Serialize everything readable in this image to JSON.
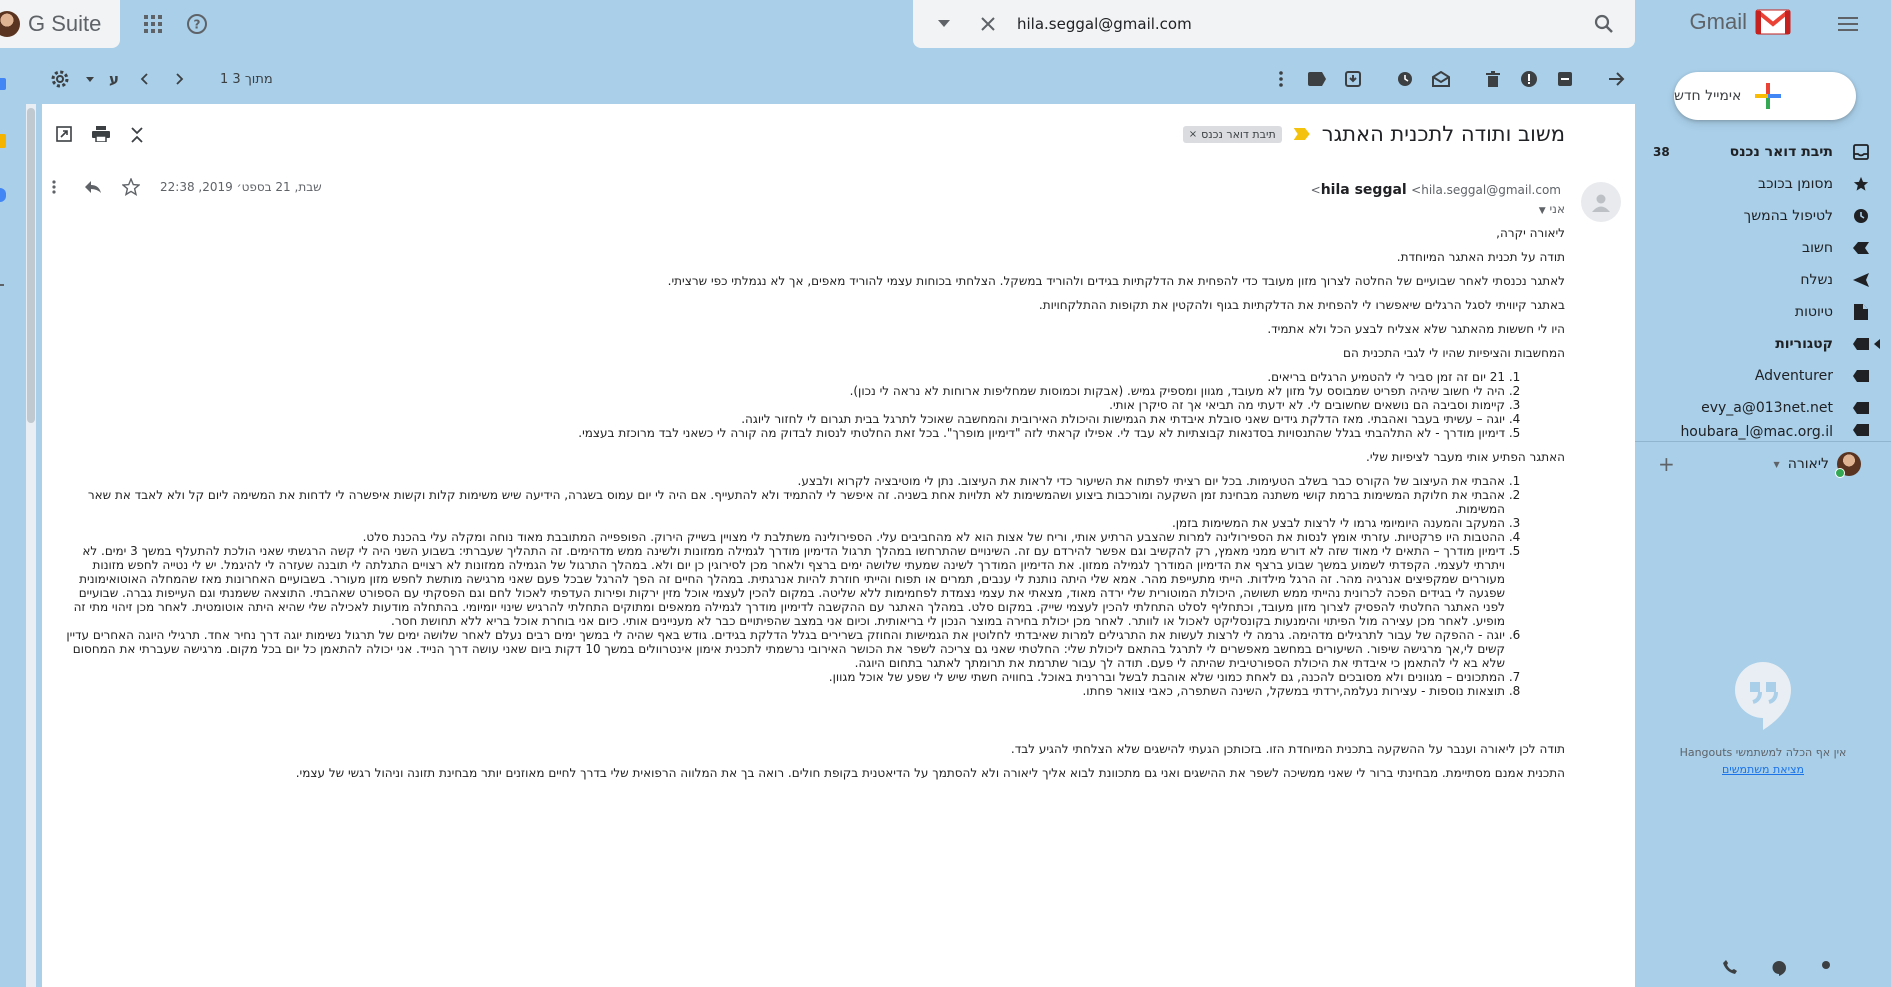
{
  "topbar": {
    "brand": "G Suite",
    "search_value": "hila.seggal@gmail.com",
    "gmail_label": "Gmail"
  },
  "toolbar": {
    "pager": "1 מתוך 3",
    "input_tools_label": "ע"
  },
  "email": {
    "subject": "משוב ותודה לתכנית האתגר",
    "label_chip": "תיבת דואר נכנס",
    "sender_name": "hila seggal",
    "sender_email": "<hila.seggal@gmail.com>",
    "to": "אני",
    "date": "שבת, 21 בספט׳ 2019, 22:38",
    "body": {
      "greeting": "ליאורה יקרה,",
      "p1": "תודה על תכנית האתגר המיוחדת.",
      "p2": "לאתגר נכנסתי לאחר שבועיים של החלטה לצרוך מזון מעובד כדי להפחית את הדלקתיות בגידים ולהוריד במשקל. הצלחתי  בכוחות עצמי להוריד מאפים, אך לא נגמלתי כפי שרציתי.",
      "p3": "באתגר קיוויתי לסגל הרגלים שיאפשרו לי להפחית את הדלקתיות בגוף ולהקטין את תקופות ההתלקחויות.",
      "p4": "היו לי חששות מהאתגר שלא אצליח לבצע הכל ולא אתמיד.",
      "p5": "המחשבות והציפיות שהיו לי לגבי התכנית הם",
      "list1": [
        "21 יום זה זמן סביר לי להטמיע הרגלים בריאים.",
        "היה לי חשוב שיהיה תפריט שמבוסס על מזון לא מעובד, מגוון ומספיק גמיש. (אבקות וכמוסות שמחליפות ארוחות לא נראה לי נכון).",
        "קיימות וסביבה הם נושאים שחשובים לי. לא ידעתי מה תביאי אך זה סיקרן אותי.",
        "יוגה – עשיתי בעבר ואהבתי. מאז הדלקת גידים שאני סובלת איבדתי את הגמישות והיכולת האירובית והמחשבה שאוכל לתרגל בבית תגרום לי לחזור ליוגה.",
        "דימיון מודרך -  לא התלהבתי בגלל שהתנסויות בסדנאות קבוצתיות לא עבד לי. אפילו קראתי לזה \"דימיון מופרך\". בכל זאת החלטתי לנסות לבדוק מה קורה לי כשאני לבד מרוכזת בעצמי."
      ],
      "p6": "האתגר הפתיע אותי מעבר לציפיות שלי.",
      "list2": [
        "אהבתי את העיצוב של הקורס כבר בשלב הטעימות. בכל יום רציתי לפתוח את השיעור כדי לראות את העיצוב. נתן לי מוטיבציה לקרוא ולבצע.",
        "אהבתי את חלוקת המשימות ברמת קושי משתנה מבחינת זמן השקעה ומורכבות ביצוע ושהמשימות לא תלויות אחת בשניה.  זה איפשר לי להתמיד ולא להתעייף. אם היה לי יום עמוס בשגרה, הידיעה שיש משימות קלות וקשות איפשרה לי לדחות את המשימה ליום קל ולא לאבד את שאר המשימות.",
        "המעקב והמענה היומיומי גרמו לי לרצות לבצע את המשימות בזמן.",
        "ההטבות היו פרקטיות. עזרתי אומץ לנסות את הספירולינה למרות שהצבע הרתיע אותי, וריח של אצות הוא לא מהחביבים עלי. הספירולינה משתלבת לי מצויין בשייק הירוק. הפופפייה המתובבת מאוד נוחה ומקלה עלי בהכנת סלט.",
        "דימיון מודרך –  התאים לי מאוד שזה לא דורש ממני מאמץ, רק להקשיב וגם אפשר להירדם עם זה. השינויים שהתרחשו במהלך תרגול הדימיון מודרך לגמילה ממזונות ולשינה ממש מדהימים. זה התהליך שעברתי: בשבוע השני היה לי קשה הרגשתי שאני הולכת להתעלף במשך 3 ימים. לא ויתרתי לעצמי. הקפדתי לשמוע במשך שבוע ברצף את הדימיון המודרך לגמילה ממזון. את הדימיון המודרך לשינה שמעתי שלושה ימים ברצף ולאחר מכן לסירוגין כן יום ולא. במהלך התרגול של הגמילה ממזונות לא רצויים התגלתה לי תובנה שעזרה לי להיגמל. יש לי נטייה לחפש מזונות מעוררים שמקפיצים אנרגיה מהר. זה הרגל מילדות. הייתי מתעייפת מהר. אמא  שלי היתה נותנת לי ענבים, תמרים או תפוח והייתי חוזרת להיות אנרגתית. במהלך החיים זה הפך להרגל שבכל פעם שאני מרגישה מותשת לחפש מזון מעורר. בשבועיים האחרונות מאז שהמחלה האוטואימונית שפגעה לי בגידים הפכה לכרונית נהייתי ממש תשושה, היכולת המוטורית שלי ירדה מאוד, מצאתי את עצמי נצמדת לפחמימות ללא שליטה. במקום להכין לעצמי אוכל מזין ירקות ופירות העדפתי לאכול לחם וגם הפסקתי עם הספורט שאהבתי. התוצאה ששמנתי וגם העייפות גברה. שבועיים לפני האתגר החלטתי להפסיק לצרוך מזון מעובד, וכתחליף לסלט התחלתי להכין לעצמי שייק. במקום סלט. במהלך האתגר עם ההקשבה לדימיון מודרך לגמילה ממאפים ומתוקים התחלתי להרגיש שינוי יומיומי. בהתחלה מודעות לאכילה שלי שהיא היתה אוטומטית. לאחר מכן זיהוי מתי זה מופיע. לאחר מכן  עצירה מול הפיתוי והימנעות בקונסליקט לאכול או לוותר. לאחר מכן יכולת בחירה במוצר הנכון לי בריאותית. וכיום אני במצב שהפיתויים כבר לא מעניינים אותי. כיום אני בוחרת אוכל בריא ללא תחושת חסר.",
        "יוגה -  ההפקה של עבור לתרגילים מדהימה. גרמה לי לרצות לעשות את התרגילים למרות שאיבדתי לחלוטין את הגמישות והחוזק בשרירים בגלל הדלקת בגידים. גודש באף שהיה לי במשך ימים רבים נעלם לאחר שלושה ימים של תרגול נשימות יוגה דרך נחיר אחד. תרגילי היוגה האחרים עדיין קשים לי,אך מרגישה שיפור. השיעורים במחשב מאפשרים לי לתרגל בהתאם ליכולת שלי: החלטתי שאני גם צריכה  לשפר את הכושר האירובי נרשמתי לתכנית אימון אינטרוולים במשך 10 דקות ביום שאני עושה דרך הנייד. אני יכולה להתאמן כל יום בכל מקום. מרגישה שעברתי את המחסום שלא בא לי להתאמן כי איבדתי את היכולת הספורטיבית שהיתה לי פעם. תודה לך עבור  שתרמת את תרומתך לאתגר בתחום היוגה.",
        "המתכונים – מגוונים ולא מסובכים להכנה, גם לאחת כמוני שלא אוהבת לבשל ובררנית באוכל. בחוויה חשתי שיש לי שפע של אוכל מגוון.",
        "תוצאות נוספות  - עצירות נעלמה,ירדתי במשקל, השינה השתפרה, כאבי צוואר פחתו."
      ],
      "p7": "תודה לכן ליאורה וענבר על ההשקעה בתכנית המיוחדת הזו. בזכותכן הגעתי להישגים שלא הצלחתי להגיע לבד.",
      "p8": "התכנית אמנם מסתיימת. מבחינתי ברור לי שאני ממשיכה לשפר את ההישגים ואני גם מתכוונת לבוא אליך ליאורה ולא להסתמך על הדיאטנית  בקופת חולים. רואה בך את המלווה הרפואית שלי בדרך לחיים מאוזנים יותר מבחינת תזונה וניהול רגשי של עצמי."
    }
  },
  "sidebar": {
    "compose_label": "אימייל חדש",
    "nav": [
      {
        "label": "תיבת דואר נכנס",
        "count": "38",
        "icon": "inbox-icon",
        "bold": true
      },
      {
        "label": "מסומן בכוכב",
        "icon": "star-icon"
      },
      {
        "label": "לטיפול בהמשך",
        "icon": "clock-icon"
      },
      {
        "label": "חשוב",
        "icon": "label-important-icon"
      },
      {
        "label": "נשלח",
        "icon": "send-icon"
      },
      {
        "label": "טיוטות",
        "icon": "draft-icon"
      },
      {
        "label": "קטגוריות",
        "icon": "label-icon",
        "bold": true
      },
      {
        "label": "Adventurer",
        "icon": "label-icon"
      },
      {
        "label": "evy_a@013net.net",
        "icon": "label-icon"
      },
      {
        "label": "houbara_l@mac.org.il",
        "icon": "label-icon"
      }
    ],
    "hangouts_user": "ליאורה",
    "hangouts_msg": "אין אף הכלה למשתמשי Hangouts",
    "hangouts_link": "מציאת משתמשים"
  },
  "colors": {
    "background": "#a9cfe9",
    "panel": "#ffffff",
    "accent_red": "#ea4335"
  }
}
